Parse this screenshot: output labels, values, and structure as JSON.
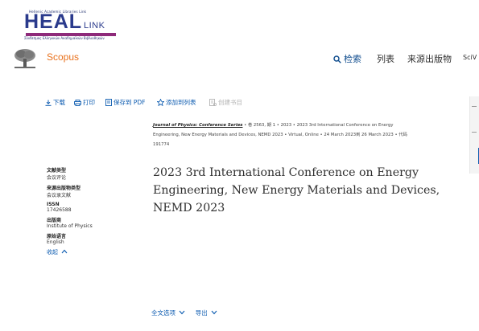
{
  "header": {
    "logo_tiny": "Hellenic Academic Libraries Link",
    "logo_main": "HEAL",
    "logo_link": "LINK",
    "logo_sub": "Σύνδεσμος Ελληνικών Ακαδημαϊκών Βιβλιοθηκών"
  },
  "nav": {
    "brand": "Scopus",
    "search": "检索",
    "lists": "列表",
    "sources": "来源出版物",
    "scival": "SciV"
  },
  "toolbar": {
    "download": "下载",
    "print": "打印",
    "save_pdf": "保存到 PDF",
    "add_list": "添加到列表",
    "create_bib": "创建书目"
  },
  "source": {
    "journal": "Journal of Physics: Conference Series",
    "line1_rest": " • 卷 2563, 期 1 • 2023 • 2023 3rd International Conference on Energy",
    "line2": "Engineering, New Energy Materials and Devices, NEMD 2023 • Virtual, Online • 24 March 2023到 26 March 2023 • 代码",
    "line3": "191774"
  },
  "title": "2023 3rd International Conference on Energy Engineering, New Energy Materials and Devices, NEMD 2023",
  "meta": {
    "doc_type_label": "文献类型",
    "doc_type_value": "会议评论",
    "source_type_label": "来源出版物类型",
    "source_type_value": "会议录文献",
    "issn_label": "ISSN",
    "issn_value": "17426588",
    "publisher_label": "出版商",
    "publisher_value": "Institute of Physics",
    "language_label": "原始语言",
    "language_value": "English",
    "collapse": "收起"
  },
  "bottom": {
    "full_text": "全文选项",
    "export": "导出"
  },
  "colors": {
    "accent_blue": "#0c5bb0",
    "scopus_orange": "#e9711c",
    "heal_blue": "#2a3a8c"
  }
}
